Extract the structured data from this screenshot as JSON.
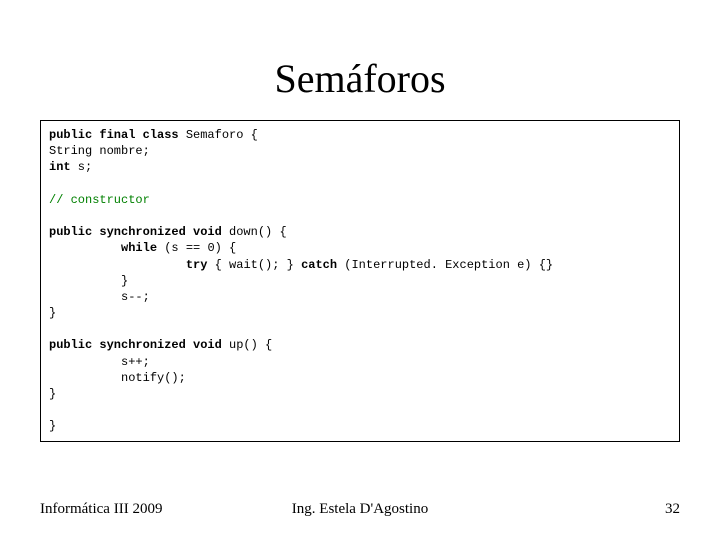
{
  "title": "Semáforos",
  "code": {
    "l1a": "public final class",
    "l1b": " Semaforo {",
    "l2": "String nombre;",
    "l3a": "int",
    "l3b": " s;",
    "l5": "// constructor",
    "l7a": "public synchronized void",
    "l7b": " down() {",
    "l8a": "          while",
    "l8b": " (s == 0) {",
    "l9a": "                   try",
    "l9b": " { wait(); } ",
    "l9c": "catch",
    "l9d": " (Interrupted. Exception e) {}",
    "l10": "          }",
    "l11": "          s--;",
    "l12": "}",
    "l14a": "public synchronized void",
    "l14b": " up() {",
    "l15": "          s++;",
    "l16": "          notify();",
    "l17": "}",
    "l19": "}"
  },
  "footer": {
    "left": "Informática III 2009",
    "center": "Ing. Estela D'Agostino",
    "right": "32"
  }
}
